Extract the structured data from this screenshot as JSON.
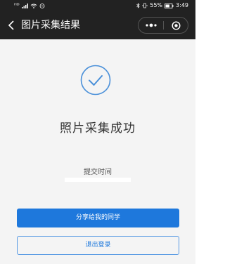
{
  "status_bar": {
    "signal": "ᴴᴰ",
    "battery_text": "55%",
    "time": "3:49"
  },
  "nav": {
    "title": "图片采集结果",
    "capsule_more": "•••"
  },
  "result": {
    "title": "照片采集成功",
    "time_label": "提交时间"
  },
  "actions": {
    "share_label": "分享给我的同学",
    "logout_label": "退出登录"
  },
  "colors": {
    "accent": "#1e78dc",
    "nav_bg": "#222222",
    "content_bg": "#f4f4f4"
  },
  "icons": {
    "back": "chevron-left-icon",
    "success": "check-circle-icon",
    "capsule_close": "target-icon"
  }
}
